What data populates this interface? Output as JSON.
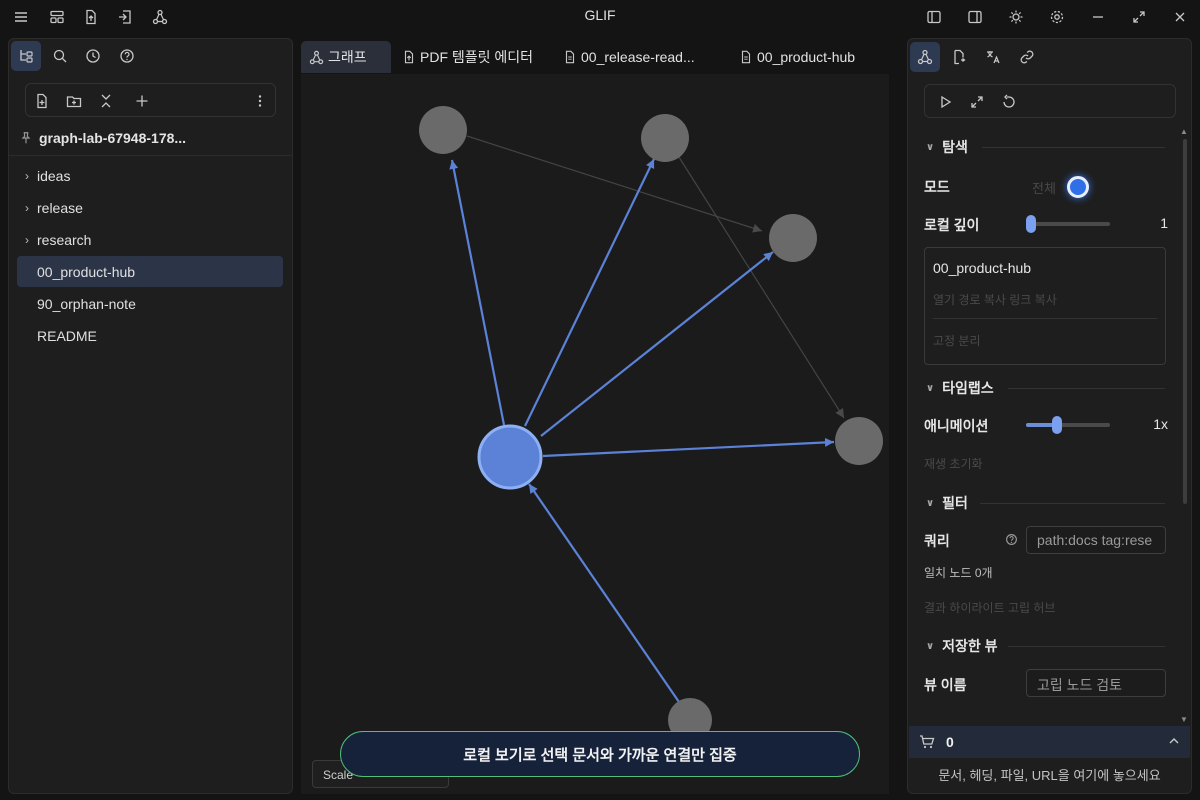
{
  "app": {
    "title": "GLIF"
  },
  "titlebar": {
    "left_icons": [
      "menu-icon",
      "layout-icon",
      "file-export-icon",
      "file-import-icon",
      "graph-icon"
    ],
    "right_icons": [
      "sidebar-left-icon",
      "sidebar-right-icon",
      "theme-icon",
      "settings-icon",
      "minimize-icon",
      "maximize-icon",
      "close-icon"
    ]
  },
  "left_panel": {
    "tabs": [
      "tree-icon",
      "search-icon",
      "history-icon",
      "help-icon"
    ],
    "toolbar_icons": [
      "new-file-icon",
      "new-folder-icon",
      "collapse-icon",
      "add-icon",
      "more-icon"
    ],
    "vault_name": "graph-lab-67948-178...",
    "tree": [
      {
        "label": "ideas",
        "folder": true,
        "selected": false
      },
      {
        "label": "release",
        "folder": true,
        "selected": false
      },
      {
        "label": "research",
        "folder": true,
        "selected": false
      },
      {
        "label": "00_product-hub",
        "folder": false,
        "selected": true
      },
      {
        "label": "90_orphan-note",
        "folder": false,
        "selected": false
      },
      {
        "label": "README",
        "folder": false,
        "selected": false
      }
    ]
  },
  "tabs": [
    {
      "label": "그래프",
      "icon": "graph-icon",
      "active": true
    },
    {
      "label": "PDF 템플릿 에디터",
      "icon": "file-export-icon",
      "active": false
    },
    {
      "label": "00_release-read...",
      "icon": "document-icon",
      "active": false
    },
    {
      "label": "00_product-hub",
      "icon": "document-icon",
      "active": false
    }
  ],
  "graph": {
    "scale_label": "Scale",
    "colors": {
      "center": "#5b82d6",
      "node": "#6a6a6a",
      "edge_active": "#5b82d6",
      "edge_inactive": "#444444"
    }
  },
  "toast": {
    "text": "로컬 보기로 선택 문서와 가까운 연결만 집중"
  },
  "right_panel": {
    "tabs": [
      "graph-icon",
      "file-link-icon",
      "translate-icon",
      "link-icon"
    ],
    "toolbar_icons": [
      "play-icon",
      "expand-icon",
      "reset-icon"
    ],
    "explore": {
      "title": "탐색",
      "mode_label": "모드",
      "mode_value": "전체",
      "depth_label": "로컬 깊이",
      "depth_value": "1",
      "depth_fraction": 0.0,
      "focus_note": "00_product-hub",
      "actions_faint": "열기  경로 복사  링크 복사",
      "actions2_faint": "고정  분리"
    },
    "timelapse": {
      "title": "타임랩스",
      "anim_label": "애니메이션",
      "anim_value": "1x",
      "anim_fraction": 0.35,
      "faint": "재생  초기화"
    },
    "filter": {
      "title": "필터",
      "query_label": "쿼리",
      "query_placeholder": "path:docs tag:rese",
      "match_text": "일치 노드 0개",
      "faint": "결과 하이라이트  고립  허브  "
    },
    "saved": {
      "title": "저장한 뷰",
      "name_label": "뷰 이름",
      "name_placeholder": "고립 노드 검토"
    },
    "cart": {
      "count": "0"
    },
    "drop_hint": "문서, 헤딩, 파일, URL을 여기에 놓으세요"
  }
}
